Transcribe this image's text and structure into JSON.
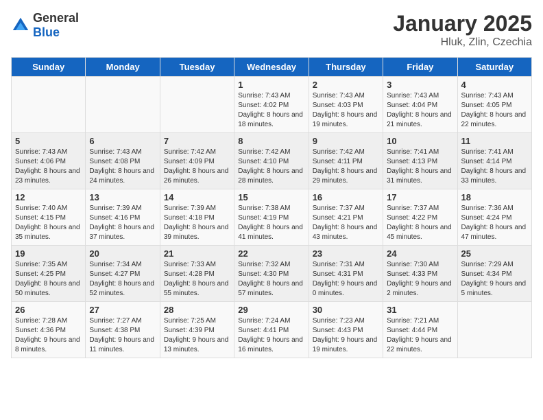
{
  "logo": {
    "general": "General",
    "blue": "Blue"
  },
  "title": "January 2025",
  "location": "Hluk, Zlin, Czechia",
  "days_of_week": [
    "Sunday",
    "Monday",
    "Tuesday",
    "Wednesday",
    "Thursday",
    "Friday",
    "Saturday"
  ],
  "weeks": [
    [
      {
        "day": "",
        "info": ""
      },
      {
        "day": "",
        "info": ""
      },
      {
        "day": "",
        "info": ""
      },
      {
        "day": "1",
        "info": "Sunrise: 7:43 AM\nSunset: 4:02 PM\nDaylight: 8 hours and 18 minutes."
      },
      {
        "day": "2",
        "info": "Sunrise: 7:43 AM\nSunset: 4:03 PM\nDaylight: 8 hours and 19 minutes."
      },
      {
        "day": "3",
        "info": "Sunrise: 7:43 AM\nSunset: 4:04 PM\nDaylight: 8 hours and 21 minutes."
      },
      {
        "day": "4",
        "info": "Sunrise: 7:43 AM\nSunset: 4:05 PM\nDaylight: 8 hours and 22 minutes."
      }
    ],
    [
      {
        "day": "5",
        "info": "Sunrise: 7:43 AM\nSunset: 4:06 PM\nDaylight: 8 hours and 23 minutes."
      },
      {
        "day": "6",
        "info": "Sunrise: 7:43 AM\nSunset: 4:08 PM\nDaylight: 8 hours and 24 minutes."
      },
      {
        "day": "7",
        "info": "Sunrise: 7:42 AM\nSunset: 4:09 PM\nDaylight: 8 hours and 26 minutes."
      },
      {
        "day": "8",
        "info": "Sunrise: 7:42 AM\nSunset: 4:10 PM\nDaylight: 8 hours and 28 minutes."
      },
      {
        "day": "9",
        "info": "Sunrise: 7:42 AM\nSunset: 4:11 PM\nDaylight: 8 hours and 29 minutes."
      },
      {
        "day": "10",
        "info": "Sunrise: 7:41 AM\nSunset: 4:13 PM\nDaylight: 8 hours and 31 minutes."
      },
      {
        "day": "11",
        "info": "Sunrise: 7:41 AM\nSunset: 4:14 PM\nDaylight: 8 hours and 33 minutes."
      }
    ],
    [
      {
        "day": "12",
        "info": "Sunrise: 7:40 AM\nSunset: 4:15 PM\nDaylight: 8 hours and 35 minutes."
      },
      {
        "day": "13",
        "info": "Sunrise: 7:39 AM\nSunset: 4:16 PM\nDaylight: 8 hours and 37 minutes."
      },
      {
        "day": "14",
        "info": "Sunrise: 7:39 AM\nSunset: 4:18 PM\nDaylight: 8 hours and 39 minutes."
      },
      {
        "day": "15",
        "info": "Sunrise: 7:38 AM\nSunset: 4:19 PM\nDaylight: 8 hours and 41 minutes."
      },
      {
        "day": "16",
        "info": "Sunrise: 7:37 AM\nSunset: 4:21 PM\nDaylight: 8 hours and 43 minutes."
      },
      {
        "day": "17",
        "info": "Sunrise: 7:37 AM\nSunset: 4:22 PM\nDaylight: 8 hours and 45 minutes."
      },
      {
        "day": "18",
        "info": "Sunrise: 7:36 AM\nSunset: 4:24 PM\nDaylight: 8 hours and 47 minutes."
      }
    ],
    [
      {
        "day": "19",
        "info": "Sunrise: 7:35 AM\nSunset: 4:25 PM\nDaylight: 8 hours and 50 minutes."
      },
      {
        "day": "20",
        "info": "Sunrise: 7:34 AM\nSunset: 4:27 PM\nDaylight: 8 hours and 52 minutes."
      },
      {
        "day": "21",
        "info": "Sunrise: 7:33 AM\nSunset: 4:28 PM\nDaylight: 8 hours and 55 minutes."
      },
      {
        "day": "22",
        "info": "Sunrise: 7:32 AM\nSunset: 4:30 PM\nDaylight: 8 hours and 57 minutes."
      },
      {
        "day": "23",
        "info": "Sunrise: 7:31 AM\nSunset: 4:31 PM\nDaylight: 9 hours and 0 minutes."
      },
      {
        "day": "24",
        "info": "Sunrise: 7:30 AM\nSunset: 4:33 PM\nDaylight: 9 hours and 2 minutes."
      },
      {
        "day": "25",
        "info": "Sunrise: 7:29 AM\nSunset: 4:34 PM\nDaylight: 9 hours and 5 minutes."
      }
    ],
    [
      {
        "day": "26",
        "info": "Sunrise: 7:28 AM\nSunset: 4:36 PM\nDaylight: 9 hours and 8 minutes."
      },
      {
        "day": "27",
        "info": "Sunrise: 7:27 AM\nSunset: 4:38 PM\nDaylight: 9 hours and 11 minutes."
      },
      {
        "day": "28",
        "info": "Sunrise: 7:25 AM\nSunset: 4:39 PM\nDaylight: 9 hours and 13 minutes."
      },
      {
        "day": "29",
        "info": "Sunrise: 7:24 AM\nSunset: 4:41 PM\nDaylight: 9 hours and 16 minutes."
      },
      {
        "day": "30",
        "info": "Sunrise: 7:23 AM\nSunset: 4:43 PM\nDaylight: 9 hours and 19 minutes."
      },
      {
        "day": "31",
        "info": "Sunrise: 7:21 AM\nSunset: 4:44 PM\nDaylight: 9 hours and 22 minutes."
      },
      {
        "day": "",
        "info": ""
      }
    ]
  ]
}
